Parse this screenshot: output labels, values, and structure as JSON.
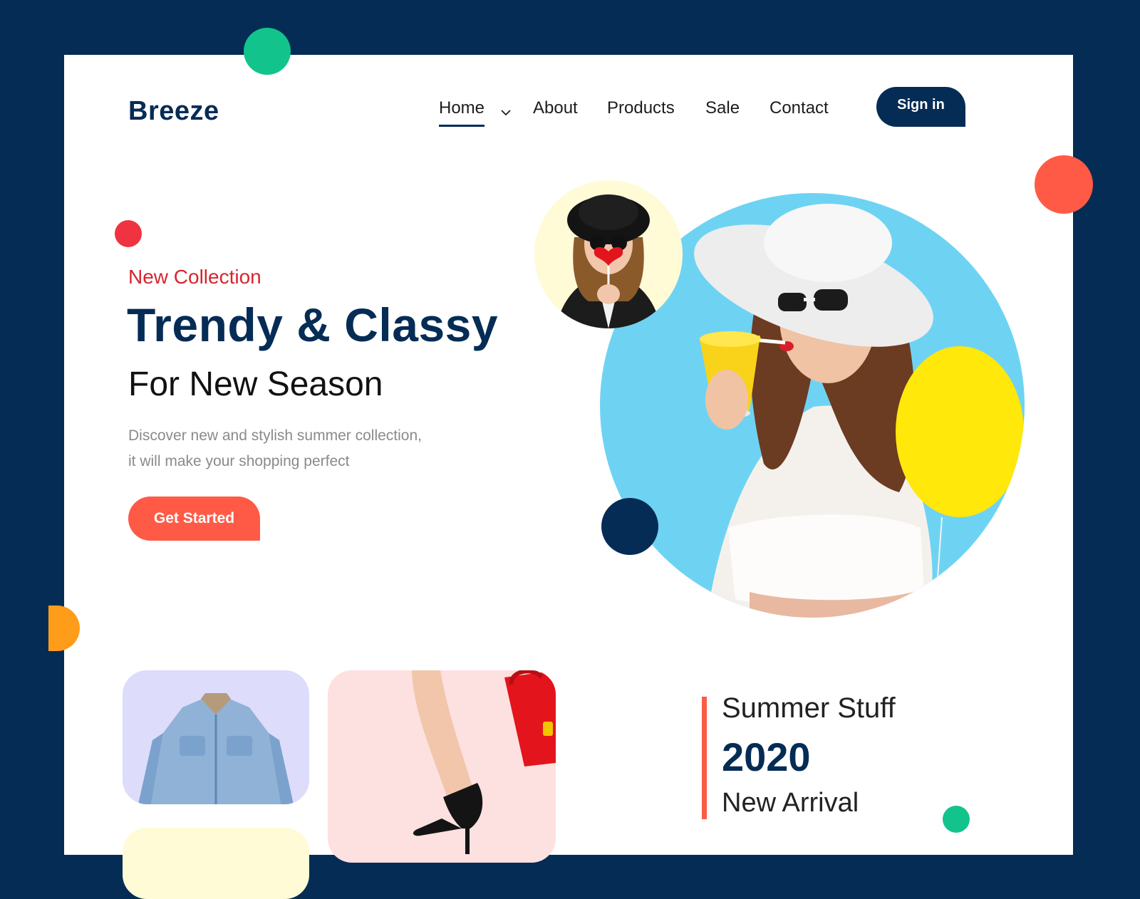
{
  "header": {
    "logo": "Breeze",
    "nav": [
      {
        "label": "Home",
        "active": true,
        "has_dropdown": true
      },
      {
        "label": "About"
      },
      {
        "label": "Products"
      },
      {
        "label": "Sale"
      },
      {
        "label": "Contact"
      }
    ],
    "signin_label": "Sign in"
  },
  "hero": {
    "eyebrow": "New Collection",
    "headline": "Trendy & Classy",
    "subheadline": "For New Season",
    "description_line1": "Discover new and stylish summer collection,",
    "description_line2": "it will make your shopping perfect",
    "cta_label": "Get Started",
    "images": [
      "woman-drinking-photo",
      "woman-heart-lollipop-photo"
    ]
  },
  "cards": [
    "denim-jacket-photo",
    "heels-and-bag-photo",
    "yellow-card"
  ],
  "summer": {
    "title": "Summer Stuff",
    "year": "2020",
    "subtitle": "New Arrival"
  },
  "colors": {
    "navy": "#052c55",
    "coral": "#ff5a46",
    "red": "#d6252f",
    "green": "#12c48b",
    "orange": "#ff9c1a"
  }
}
